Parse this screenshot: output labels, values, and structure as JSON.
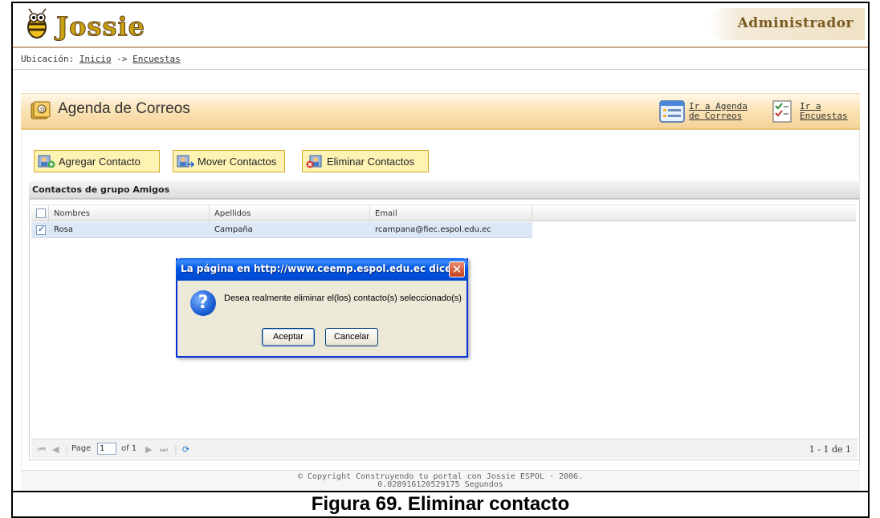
{
  "header": {
    "logo_text": "Jossie",
    "admin_label": "Administrador"
  },
  "breadcrumb": {
    "prefix": "Ubicación:",
    "home": "Inicio",
    "separator": "->",
    "current": "Encuestas"
  },
  "panel": {
    "title": "Agenda de Correos",
    "links": [
      {
        "label": "Ir a Agenda\nde Correos",
        "icon": "list-icon"
      },
      {
        "label": "Ir a\nEncuestas",
        "icon": "survey-icon"
      }
    ]
  },
  "toolbar": {
    "add_label": "Agregar Contacto",
    "move_label": "Mover Contactos",
    "delete_label": "Eliminar Contactos"
  },
  "grid": {
    "title": "Contactos de grupo Amigos",
    "columns": [
      "Nombres",
      "Apellidos",
      "Email"
    ],
    "rows": [
      {
        "checked": true,
        "nombres": "Rosa",
        "apellidos": "Campaña",
        "email": "rcampana@fiec.espol.edu.ec"
      }
    ],
    "pager": {
      "page_label": "Page",
      "page_value": "1",
      "of_label": "of 1",
      "count": "1 - 1 de 1"
    }
  },
  "dialog": {
    "title": "La página en http://www.ceemp.espol.edu.ec dice:",
    "message": "Desea realmente eliminar el(los) contacto(s) seleccionado(s)",
    "ok_label": "Aceptar",
    "cancel_label": "Cancelar"
  },
  "footer": {
    "line1": "© Copyright Construyendo tu portal con Jossie ESPOL - 2006.",
    "line2": "0.028916120529175 Segundos"
  },
  "caption": "Figura 69. Eliminar contacto",
  "colors": {
    "accent_header": "#f4d398",
    "button_bg": "#fff3b4",
    "dialog_title": "#0058e6",
    "selected_row": "#dde8f6"
  }
}
